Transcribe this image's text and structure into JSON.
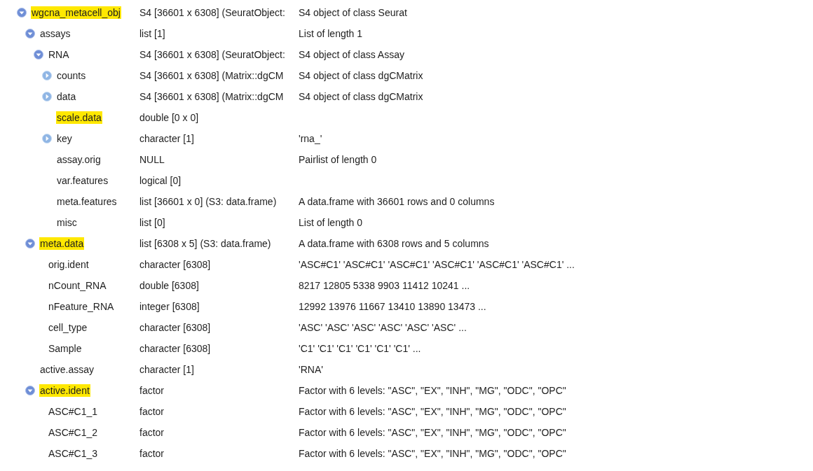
{
  "tree": [
    {
      "name": "wgcna_metacell_obj",
      "type": "S4 [36601 x 6308] (SeuratObject:",
      "value": "S4 object of class Seurat",
      "expanded": true,
      "highlighted": true,
      "children": [
        {
          "name": "assays",
          "type": "list [1]",
          "value": "List of length 1",
          "expanded": true,
          "highlighted": false,
          "children": [
            {
              "name": "RNA",
              "type": "S4 [36601 x 6308] (SeuratObject:",
              "value": "S4 object of class Assay",
              "expanded": true,
              "highlighted": false,
              "children": [
                {
                  "name": "counts",
                  "type": "S4 [36601 x 6308] (Matrix::dgCM",
                  "value": "S4 object of class dgCMatrix",
                  "expanded": false,
                  "highlighted": false
                },
                {
                  "name": "data",
                  "type": "S4 [36601 x 6308] (Matrix::dgCM",
                  "value": "S4 object of class dgCMatrix",
                  "expanded": false,
                  "highlighted": false
                },
                {
                  "name": "scale.data",
                  "type": "double [0 x 0]",
                  "highlighted": true
                },
                {
                  "name": "key",
                  "type": "character [1]",
                  "value": "'rna_'",
                  "expanded": false,
                  "highlighted": false
                },
                {
                  "name": "assay.orig",
                  "type": "NULL",
                  "value": "Pairlist of length 0",
                  "highlighted": false
                },
                {
                  "name": "var.features",
                  "type": "logical [0]",
                  "highlighted": false
                },
                {
                  "name": "meta.features",
                  "type": "list [36601 x 0] (S3: data.frame)",
                  "value": "A data.frame with 36601 rows and 0 columns",
                  "highlighted": false
                },
                {
                  "name": "misc",
                  "type": "list [0]",
                  "value": "List of length 0",
                  "highlighted": false
                }
              ]
            }
          ]
        },
        {
          "name": "meta.data",
          "type": "list [6308 x 5] (S3: data.frame)",
          "value": "A data.frame with 6308 rows and 5 columns",
          "expanded": true,
          "highlighted": true,
          "children": [
            {
              "name": "orig.ident",
              "type": "character [6308]",
              "value": "'ASC#C1' 'ASC#C1' 'ASC#C1' 'ASC#C1' 'ASC#C1' 'ASC#C1' ...",
              "highlighted": false
            },
            {
              "name": "nCount_RNA",
              "type": "double [6308]",
              "value": "8217 12805 5338 9903 11412 10241 ...",
              "highlighted": false
            },
            {
              "name": "nFeature_RNA",
              "type": "integer [6308]",
              "value": "12992 13976 11667 13410 13890 13473 ...",
              "highlighted": false
            },
            {
              "name": "cell_type",
              "type": "character [6308]",
              "value": "'ASC' 'ASC' 'ASC' 'ASC' 'ASC' 'ASC' ...",
              "highlighted": false
            },
            {
              "name": "Sample",
              "type": "character [6308]",
              "value": "'C1' 'C1' 'C1' 'C1' 'C1' 'C1' ...",
              "highlighted": false
            }
          ]
        },
        {
          "name": "active.assay",
          "type": "character [1]",
          "value": "'RNA'",
          "highlighted": false
        },
        {
          "name": "active.ident",
          "type": "factor",
          "value": "Factor with 6 levels: \"ASC\", \"EX\", \"INH\", \"MG\", \"ODC\", \"OPC\"",
          "expanded": true,
          "highlighted": true,
          "children": [
            {
              "name": "ASC#C1_1",
              "type": "factor",
              "value": "Factor with 6 levels: \"ASC\", \"EX\", \"INH\", \"MG\", \"ODC\", \"OPC\"",
              "highlighted": false
            },
            {
              "name": "ASC#C1_2",
              "type": "factor",
              "value": "Factor with 6 levels: \"ASC\", \"EX\", \"INH\", \"MG\", \"ODC\", \"OPC\"",
              "highlighted": false
            },
            {
              "name": "ASC#C1_3",
              "type": "factor",
              "value": "Factor with 6 levels: \"ASC\", \"EX\", \"INH\", \"MG\", \"ODC\", \"OPC\"",
              "highlighted": false
            }
          ]
        }
      ]
    }
  ]
}
